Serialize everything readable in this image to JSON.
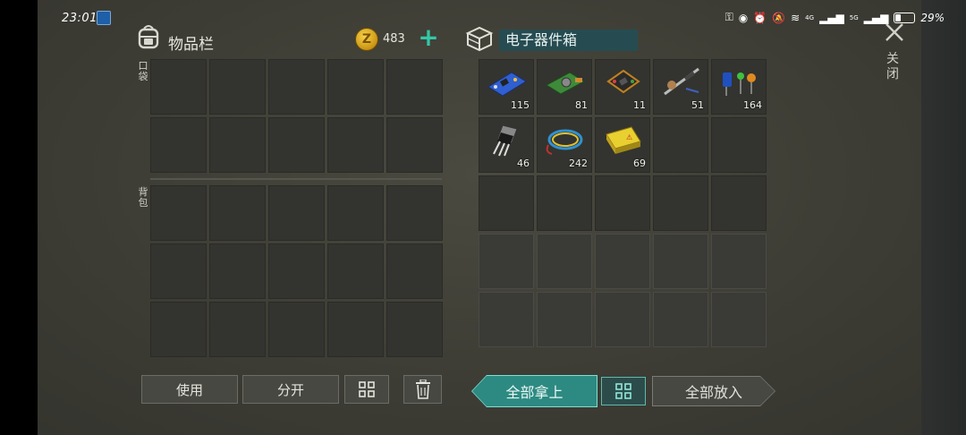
{
  "status_bar": {
    "time": "23:01",
    "network_4g": "4G",
    "network_5g": "5G",
    "battery_percent": "29%",
    "battery_level": 0.29
  },
  "inventory": {
    "title": "物品栏",
    "coins": "483",
    "pocket_label": "口袋",
    "backpack_label": "背包",
    "pocket_slots": 10,
    "backpack_slots": 15
  },
  "container": {
    "title": "电子器件箱",
    "items": [
      {
        "name": "circuit-board-blue",
        "qty": "115"
      },
      {
        "name": "sensor-module",
        "qty": "81"
      },
      {
        "name": "flight-controller",
        "qty": "11"
      },
      {
        "name": "motor-propeller-kit",
        "qty": "51"
      },
      {
        "name": "capacitors-leds",
        "qty": "164"
      },
      {
        "name": "transistor",
        "qty": "46"
      },
      {
        "name": "wire-bundle",
        "qty": "242"
      },
      {
        "name": "battery-pack",
        "qty": "69"
      }
    ]
  },
  "buttons": {
    "use": "使用",
    "split": "分开",
    "take_all": "全部拿上",
    "put_all": "全部放入",
    "close": "关闭"
  },
  "colors": {
    "accent_teal": "#2d8a82",
    "title_bg": "#264c52",
    "plus_green": "#34c7a8",
    "coin_gold": "#f7d24a"
  }
}
